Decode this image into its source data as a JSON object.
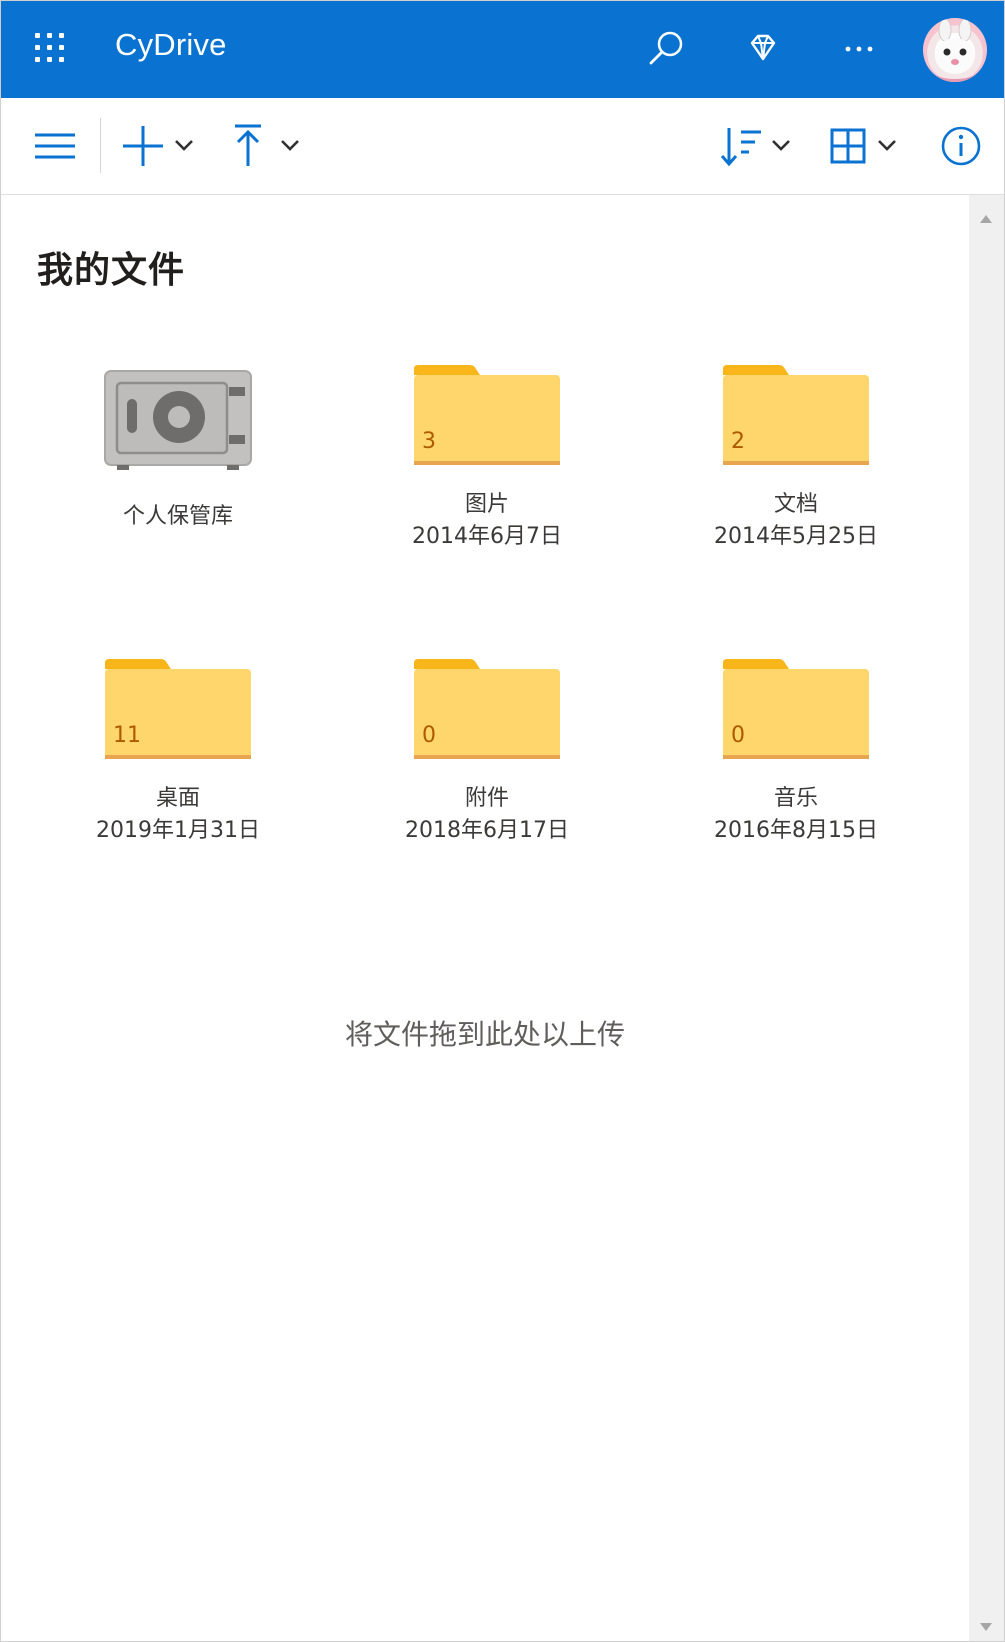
{
  "colors": {
    "brand_blue": "#0a72d1",
    "folder_yellow": "#ffd66b",
    "folder_tab": "#f9b61b",
    "count_text": "#b05a00"
  },
  "appbar": {
    "title": "CyDrive",
    "icons": [
      "app-launcher-icon",
      "search-icon",
      "premium-diamond-icon",
      "more-icon",
      "avatar"
    ]
  },
  "commandbar": {
    "icons": [
      "menu-icon",
      "new-plus-icon",
      "upload-arrow-icon",
      "sort-icon",
      "view-grid-icon",
      "info-icon"
    ]
  },
  "main": {
    "title": "我的文件",
    "items": [
      {
        "type": "vault",
        "name": "个人保管库",
        "date": ""
      },
      {
        "type": "folder",
        "name": "图片",
        "date": "2014年6月7日",
        "count": "3"
      },
      {
        "type": "folder",
        "name": "文档",
        "date": "2014年5月25日",
        "count": "2"
      },
      {
        "type": "folder",
        "name": "桌面",
        "date": "2019年1月31日",
        "count": "11"
      },
      {
        "type": "folder",
        "name": "附件",
        "date": "2018年6月17日",
        "count": "0"
      },
      {
        "type": "folder",
        "name": "音乐",
        "date": "2016年8月15日",
        "count": "0"
      }
    ],
    "drop_hint": "将文件拖到此处以上传"
  }
}
